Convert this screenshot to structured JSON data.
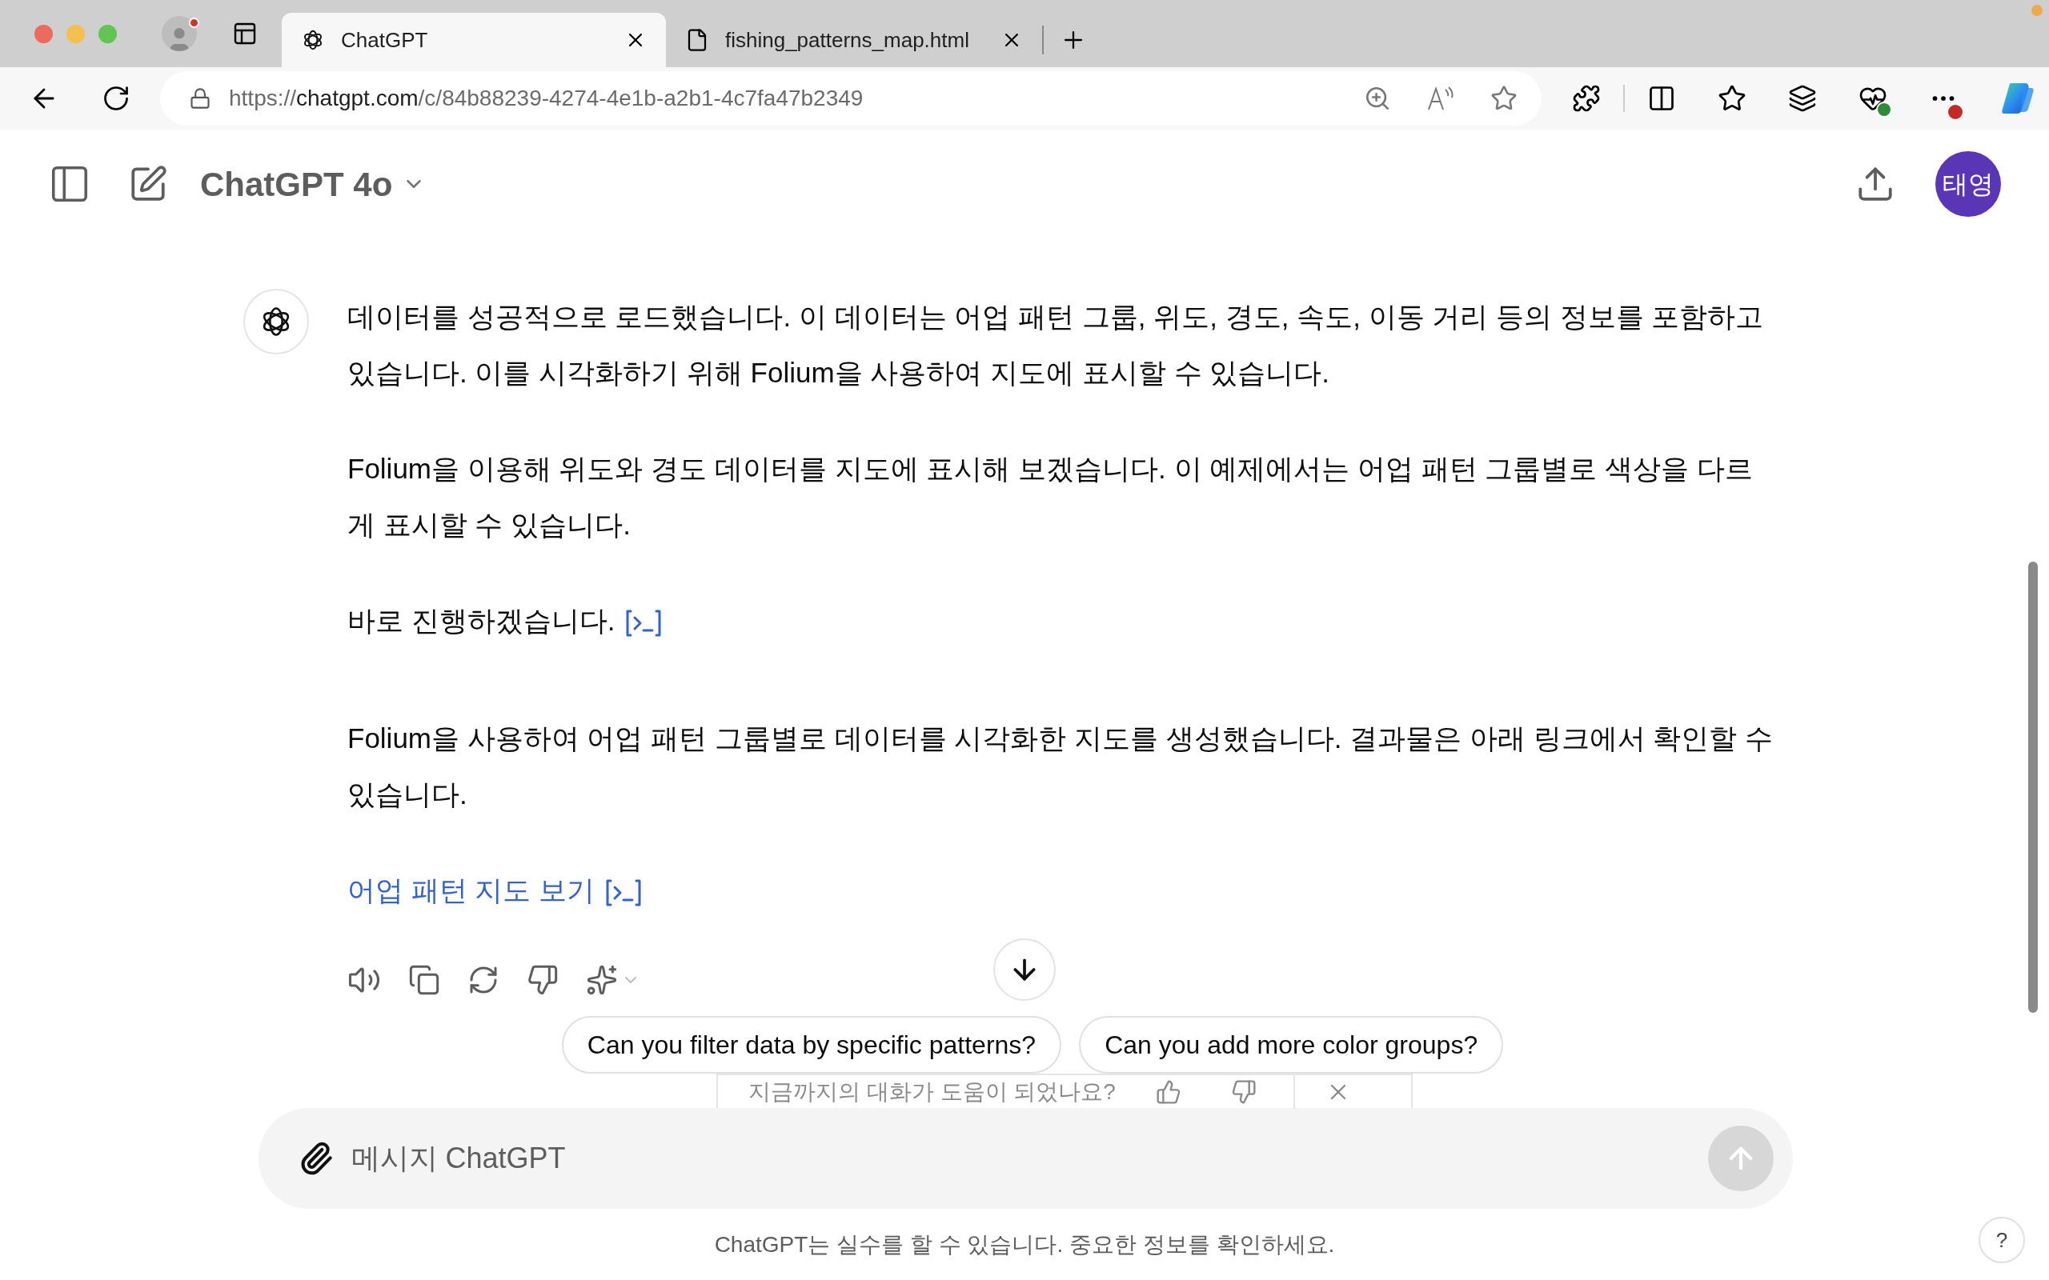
{
  "browser": {
    "tabs": [
      {
        "title": "ChatGPT",
        "kind": "chatgpt",
        "selected": true
      },
      {
        "title": "fishing_patterns_map.html",
        "kind": "file",
        "selected": false
      }
    ],
    "url": {
      "scheme": "https://",
      "host": "chatgpt.com",
      "path": "/c/84b88239-4274-4e1b-a2b1-4c7fa47b2349"
    }
  },
  "header": {
    "model": "ChatGPT 4o",
    "avatar": "태영"
  },
  "message": {
    "paragraphs": [
      {
        "kind": "text",
        "text": "데이터를 성공적으로 로드했습니다. 이 데이터는 어업 패턴 그룹, 위도, 경도, 속도, 이동 거리 등의 정보를 포함하고 있습니다. 이를 시각화하기 위해 Folium을 사용하여 지도에 표시할 수 있습니다.",
        "code_icon": false
      },
      {
        "kind": "text",
        "text": "Folium을 이용해 위도와 경도 데이터를 지도에 표시해 보겠습니다. 이 예제에서는 어업 패턴 그룹별로 색상을 다르게 표시할 수 있습니다.",
        "code_icon": false
      },
      {
        "kind": "text",
        "text": "바로 진행하겠습니다.",
        "code_icon": true
      },
      {
        "kind": "text",
        "text": "Folium을 사용하여 어업 패턴 그룹별로 데이터를 시각화한 지도를 생성했습니다. 결과물은 아래 링크에서 확인할 수 있습니다.",
        "code_icon": false
      },
      {
        "kind": "link",
        "text": "어업 패턴 지도 보기",
        "code_icon": true
      }
    ]
  },
  "suggestions": [
    "Can you filter data by specific patterns?",
    "Can you add more color groups?"
  ],
  "feedback": {
    "question": "지금까지의 대화가 도움이 되었나요?"
  },
  "composer": {
    "placeholder": "메시지 ChatGPT"
  },
  "disclaimer": "ChatGPT는 실수를 할 수 있습니다. 중요한 정보를 확인하세요.",
  "help_button": "?"
}
